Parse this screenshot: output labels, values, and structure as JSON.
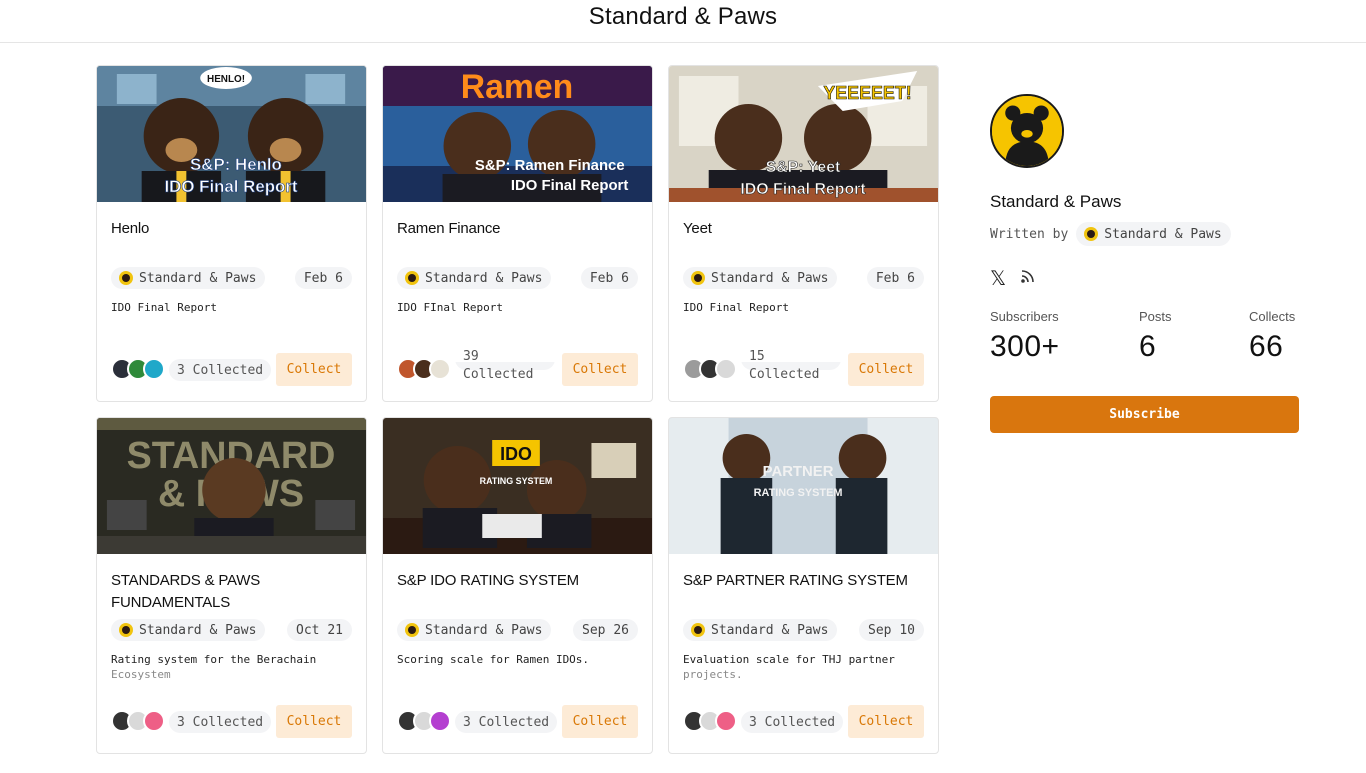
{
  "header": {
    "title": "Standard & Paws"
  },
  "posts": [
    {
      "title": "Henlo",
      "author": "Standard & Paws",
      "date": "Feb 6",
      "desc": "IDO Final Report",
      "desc2": "",
      "collected": "3 Collected",
      "collect": "Collect",
      "thumb_line1": "S&P: Henlo",
      "thumb_line2": "IDO Final Report",
      "bubble": "HENLO!"
    },
    {
      "title": "Ramen Finance",
      "author": "Standard & Paws",
      "date": "Feb 6",
      "desc": "IDO FInal Report",
      "desc2": "",
      "collected": "39 Collected",
      "collect": "Collect",
      "thumb_line1": "S&P: Ramen Finance",
      "thumb_line2": "IDO Final Report",
      "bubble": "Ramen"
    },
    {
      "title": "Yeet",
      "author": "Standard & Paws",
      "date": "Feb 6",
      "desc": "IDO Final Report",
      "desc2": "",
      "collected": "15 Collected",
      "collect": "Collect",
      "thumb_line1": "S&P: Yeet",
      "thumb_line2": "IDO Final Report",
      "bubble": "YEEEEET!"
    },
    {
      "title": "STANDARDS & PAWS FUNDAMENTALS",
      "author": "Standard & Paws",
      "date": "Oct 21",
      "desc": "Rating system for the Berachain",
      "desc2": "Ecosystem",
      "collected": "3 Collected",
      "collect": "Collect",
      "thumb_line1": "STANDARD",
      "thumb_line2": "& PAWS",
      "bubble": ""
    },
    {
      "title": "S&P IDO RATING SYSTEM",
      "author": "Standard & Paws",
      "date": "Sep 26",
      "desc": "Scoring scale for Ramen IDOs.",
      "desc2": "",
      "collected": "3 Collected",
      "collect": "Collect",
      "thumb_line1": "IDO",
      "thumb_line2": "RATING SYSTEM",
      "bubble": ""
    },
    {
      "title": "S&P PARTNER RATING SYSTEM",
      "author": "Standard & Paws",
      "date": "Sep 10",
      "desc": "Evaluation scale for THJ partner",
      "desc2": "projects.",
      "collected": "3 Collected",
      "collect": "Collect",
      "thumb_line1": "PARTNER",
      "thumb_line2": "RATING SYSTEM",
      "bubble": ""
    }
  ],
  "sidebar": {
    "name": "Standard & Paws",
    "written_by": "Written by",
    "author": "Standard & Paws",
    "stats": [
      {
        "label": "Subscribers",
        "value": "300+"
      },
      {
        "label": "Posts",
        "value": "6"
      },
      {
        "label": "Collects",
        "value": "66"
      }
    ],
    "subscribe": "Subscribe",
    "icons": [
      "x-icon",
      "rss-icon"
    ]
  },
  "colors": {
    "accent": "#d9760e",
    "collect_bg": "#fdebd6",
    "collect_text": "#d97806"
  }
}
